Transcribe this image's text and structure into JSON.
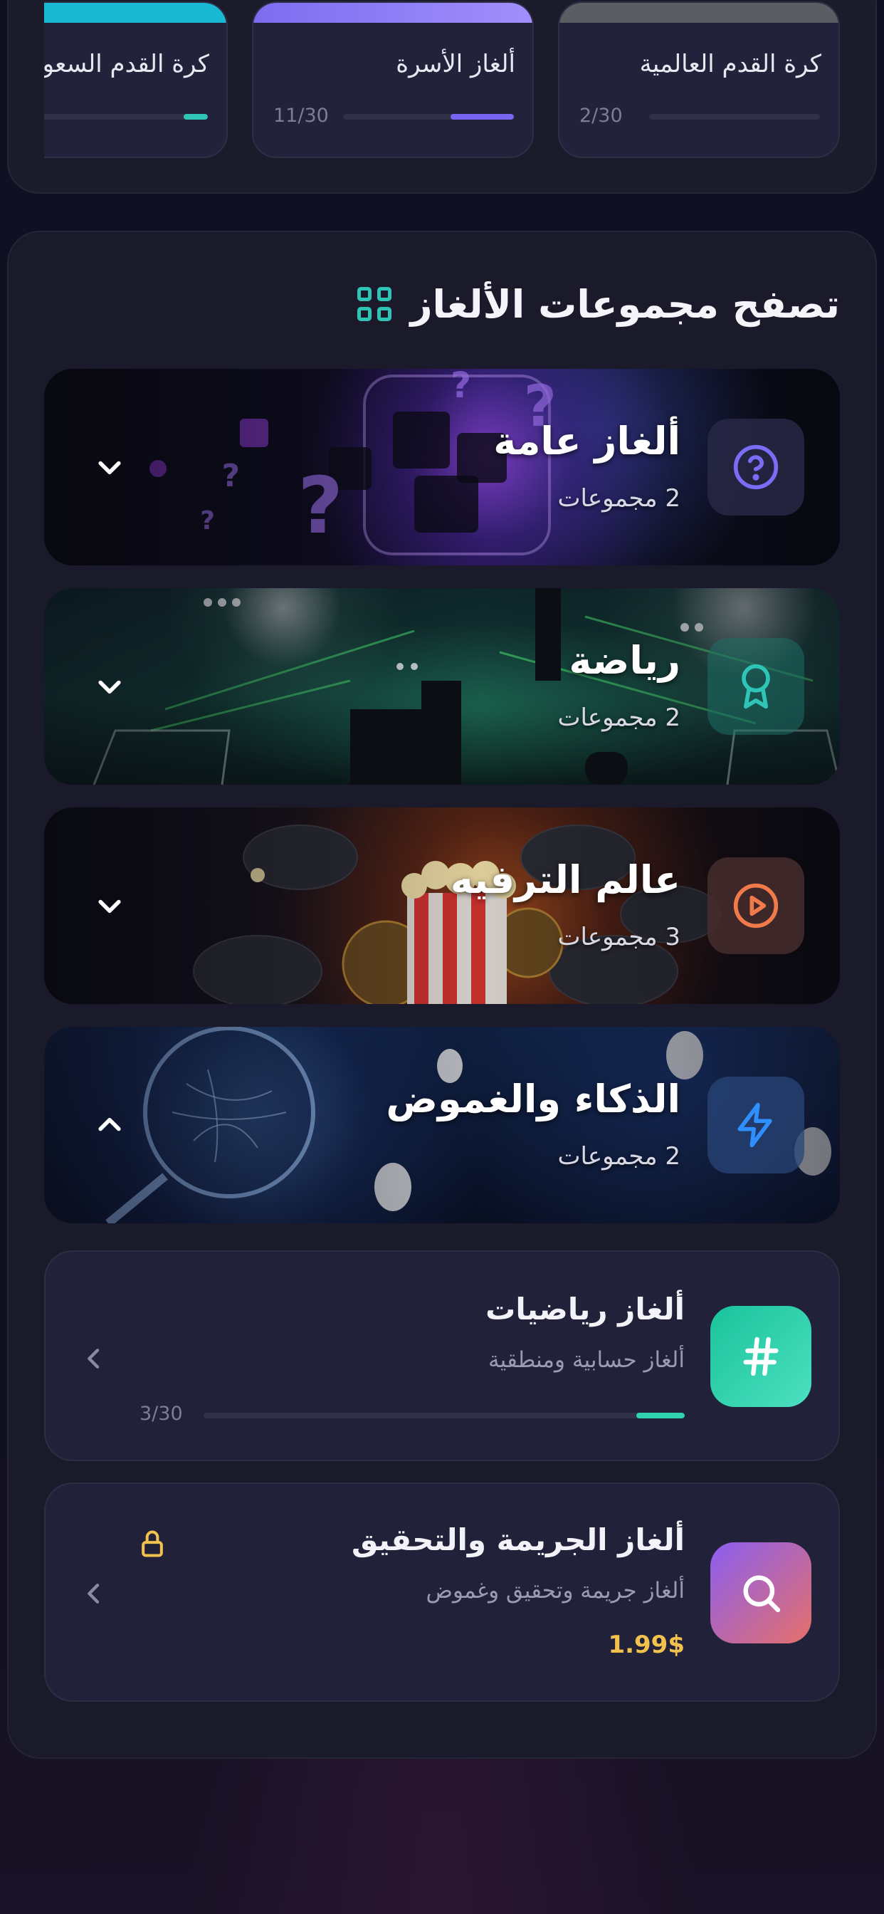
{
  "recent": {
    "cards": [
      {
        "title": "كرة القدم العالمية",
        "count": "2/30",
        "progress": 0.0,
        "banner": "#5a5e62",
        "fill": "#2ec4b6"
      },
      {
        "title": "ألغاز الأسرة",
        "count": "11/30",
        "progress": 0.37,
        "banner": "#7e6cf0",
        "fill": "#7a64f2"
      },
      {
        "title": "كرة القدم السعودية",
        "count": "",
        "progress": 0.1,
        "banner": "#19b9d4",
        "fill": "#2ec4b6"
      }
    ]
  },
  "browse": {
    "title": "تصفح مجموعات الألغاز",
    "icon": "grid-icon",
    "accent": "#2ec4b6",
    "categories": [
      {
        "title": "ألغاز عامة",
        "count": "2 مجموعات",
        "icon": "question-icon",
        "icon_color": "#7b6cf6",
        "expanded": false
      },
      {
        "title": "رياضة",
        "count": "2 مجموعات",
        "icon": "award-ribbon-icon",
        "icon_color": "#2ec4b6",
        "expanded": false
      },
      {
        "title": "عالم الترفيه",
        "count": "3 مجموعات",
        "icon": "play-circle-icon",
        "icon_color": "#f07a4a",
        "expanded": false
      },
      {
        "title": "الذكاء والغموض",
        "count": "2 مجموعات",
        "icon": "lightning-icon",
        "icon_color": "#2f8fff",
        "expanded": true
      }
    ],
    "groups": [
      {
        "title": "ألغاز رياضيات",
        "subtitle": "ألغاز حسابية ومنطقية",
        "count": "3/30",
        "progress": 0.1,
        "icon": "hash-icon",
        "locked": false
      },
      {
        "title": "ألغاز الجريمة والتحقيق",
        "subtitle": "ألغاز جريمة وتحقيق وغموض",
        "price": "1.99$",
        "icon": "search-icon",
        "locked": true
      }
    ]
  }
}
